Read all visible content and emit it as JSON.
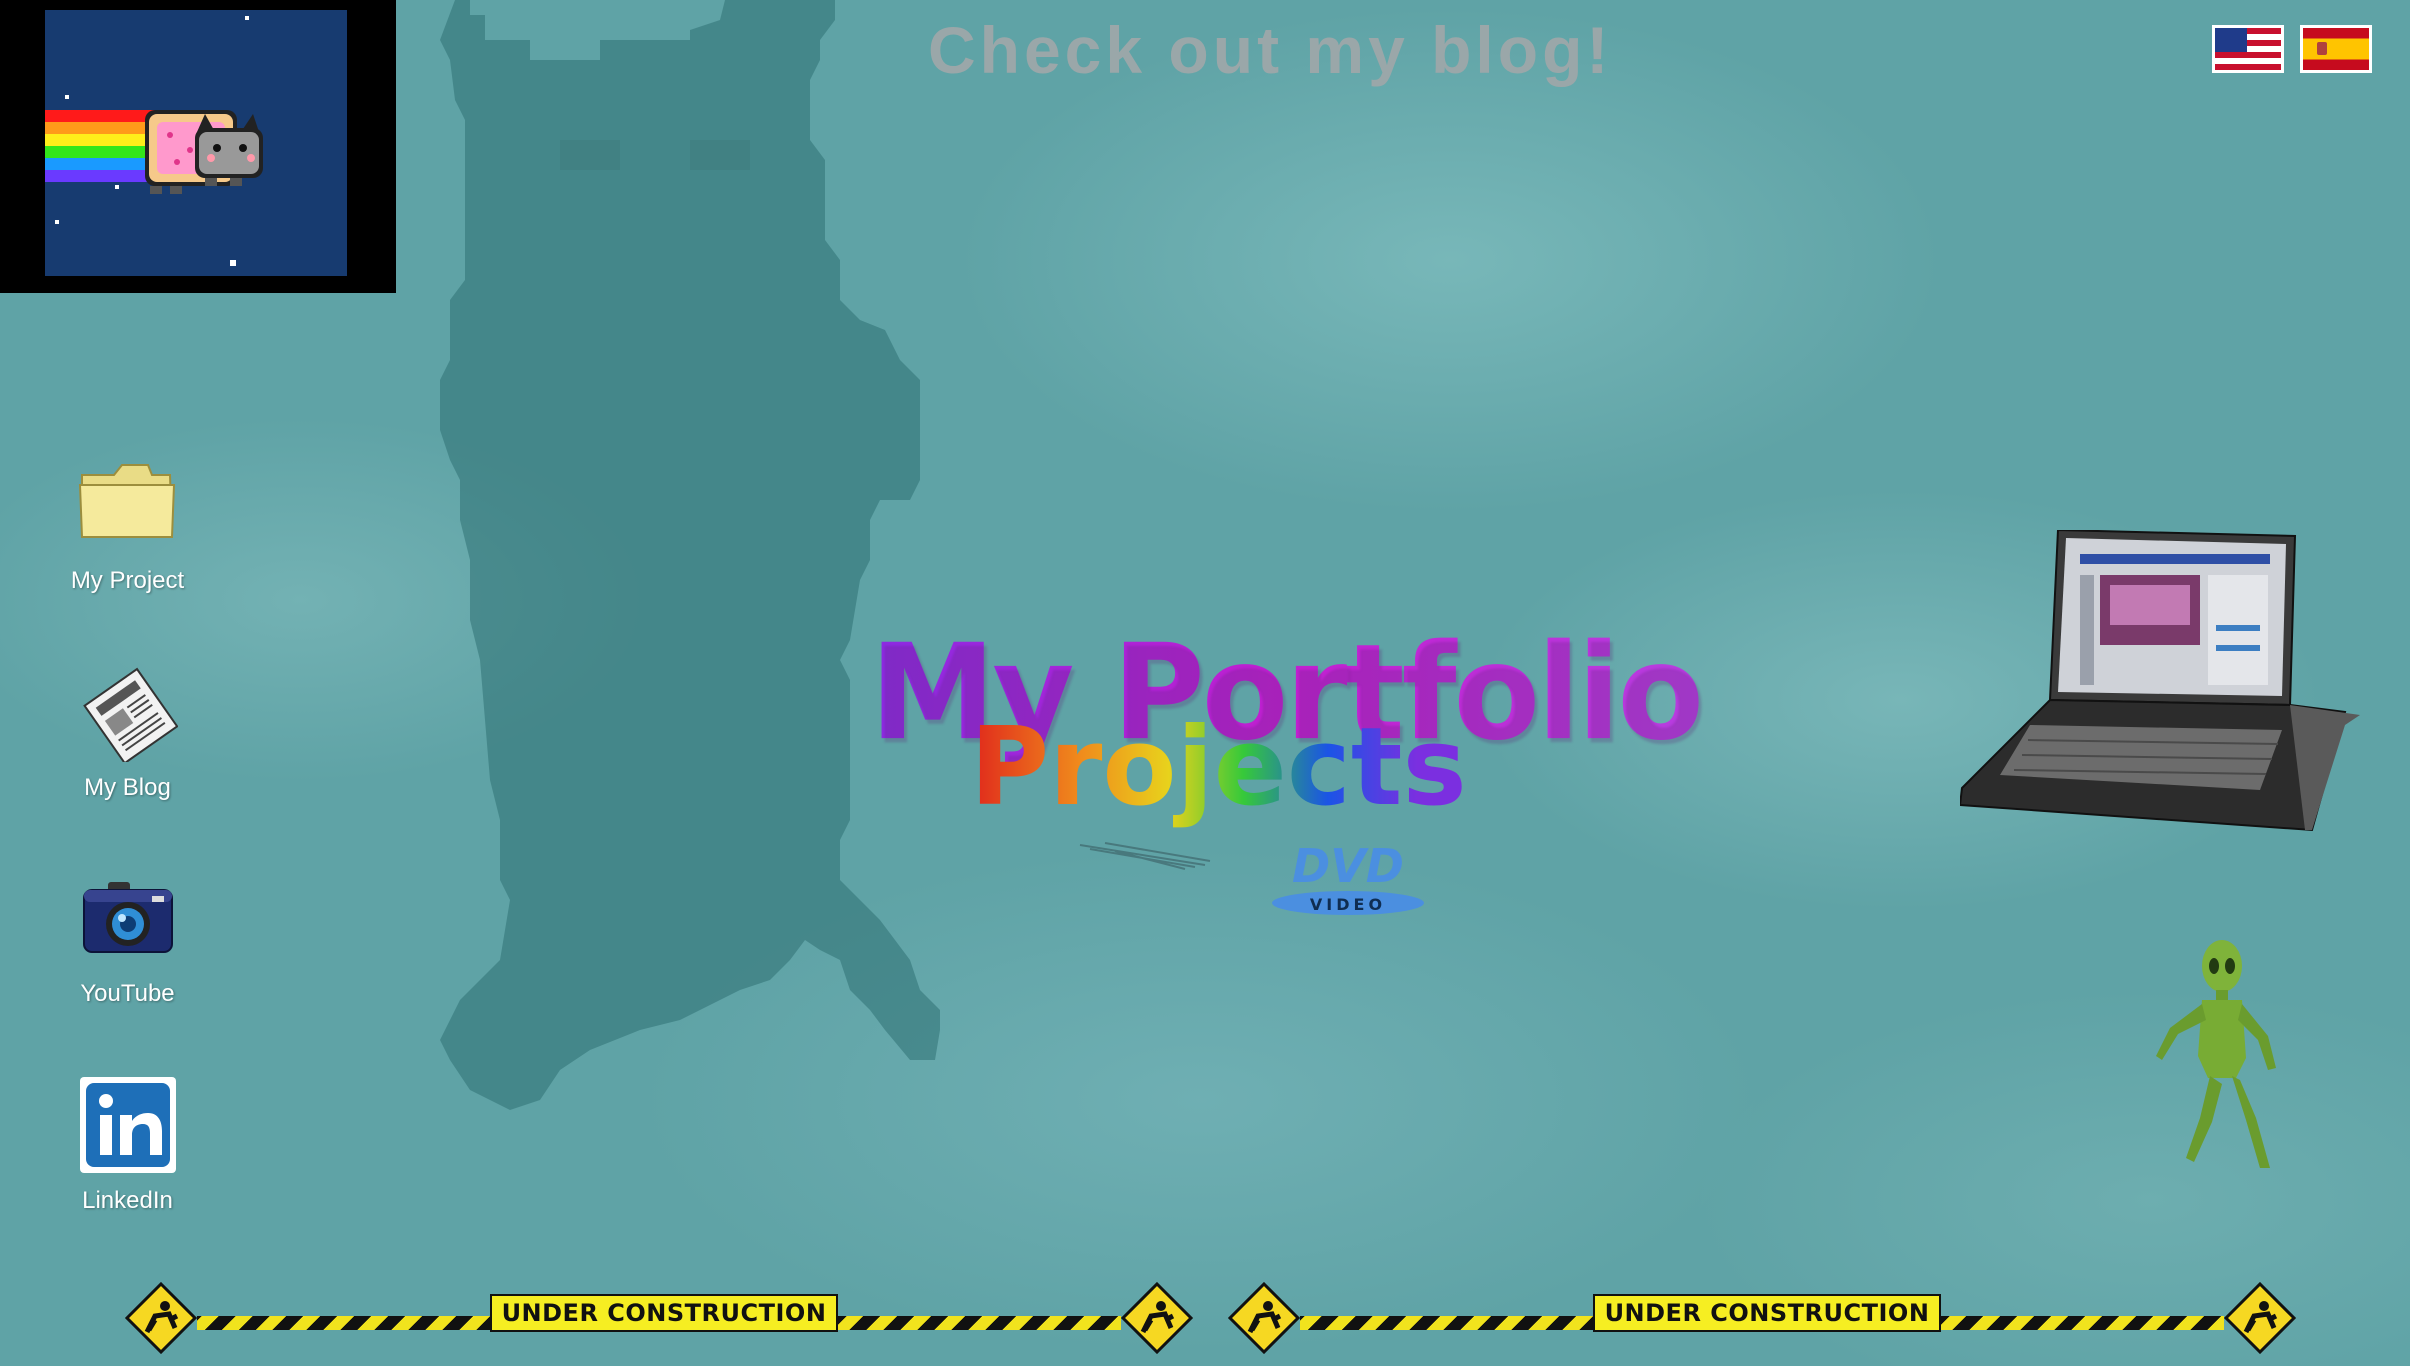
{
  "header": {
    "blog_link": "Check out my blog!",
    "flags": [
      {
        "name": "English",
        "icon": "us-flag-icon"
      },
      {
        "name": "Spanish",
        "icon": "spain-flag-icon"
      }
    ]
  },
  "desktop_icons": [
    {
      "label": "My Project",
      "icon": "folder-icon"
    },
    {
      "label": "My Blog",
      "icon": "newspaper-icon"
    },
    {
      "label": "YouTube",
      "icon": "camera-icon"
    },
    {
      "label": "LinkedIn",
      "icon": "linkedin-icon"
    }
  ],
  "main": {
    "title": "My Portfolio",
    "projects_link": "Projects",
    "dvd_logo": {
      "top": "DVD",
      "bottom": "VIDEO"
    }
  },
  "footer": {
    "construction_text": "UNDER CONSTRUCTION"
  },
  "colors": {
    "background": "#5fa3a6",
    "title": "#b12ad8",
    "blog_link": "#9aa7a9",
    "construction_yellow": "#f6ee22"
  }
}
